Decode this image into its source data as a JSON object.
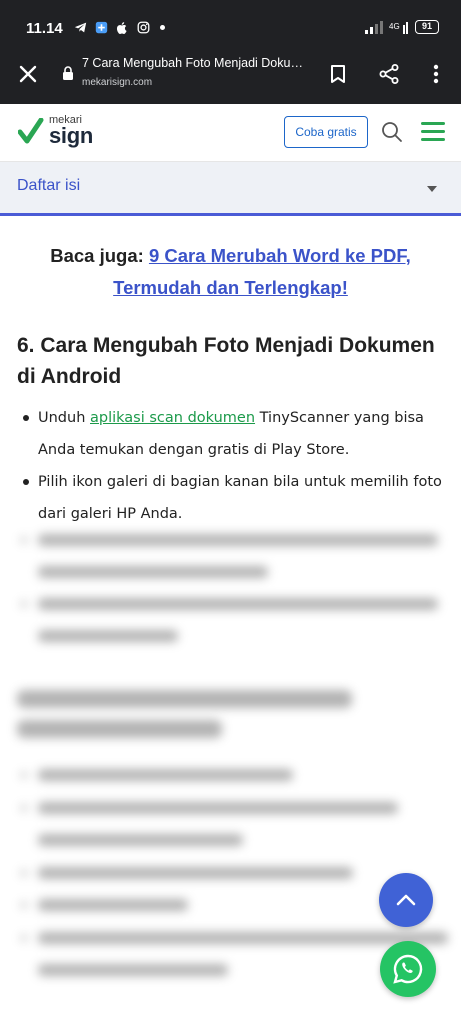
{
  "status_bar": {
    "time": "11.14",
    "battery": "91"
  },
  "browser": {
    "tab_title": "7 Cara Mengubah Foto Menjadi Dokumen ...",
    "url": "mekarisign.com"
  },
  "site_header": {
    "logo_small": "mekari",
    "logo_big": "sign",
    "cta_label": "Coba gratis"
  },
  "toc": {
    "label": "Daftar isi"
  },
  "content": {
    "also_read_prefix": "Baca juga:",
    "also_read_link": "9 Cara Merubah Word ke PDF, Termudah dan Terlengkap!",
    "heading": "6. Cara Mengubah Foto Menjadi Dokumen di Android",
    "bullets": [
      {
        "prefix": "Unduh ",
        "link": "aplikasi scan dokumen",
        "suffix": " TinyScanner yang bisa Anda temukan dengan gratis di Play Store."
      },
      {
        "text": "Pilih ikon galeri di bagian kanan bila untuk memilih foto dari galeri HP Anda."
      }
    ]
  },
  "colors": {
    "accent_blue": "#3b53c9",
    "brand_green": "#2aa653",
    "link_green": "#1c9a4a",
    "whatsapp_green": "#25c464",
    "toc_bg": "#eef1f6"
  },
  "icons": {
    "close": "close-icon",
    "lock": "lock-icon",
    "bookmark": "bookmark-icon",
    "share": "share-icon",
    "more": "more-vert-icon",
    "search": "search-icon",
    "menu": "hamburger-menu-icon",
    "caret": "chevron-down-icon",
    "scroll_top": "chevron-up-icon",
    "whatsapp": "whatsapp-icon"
  }
}
